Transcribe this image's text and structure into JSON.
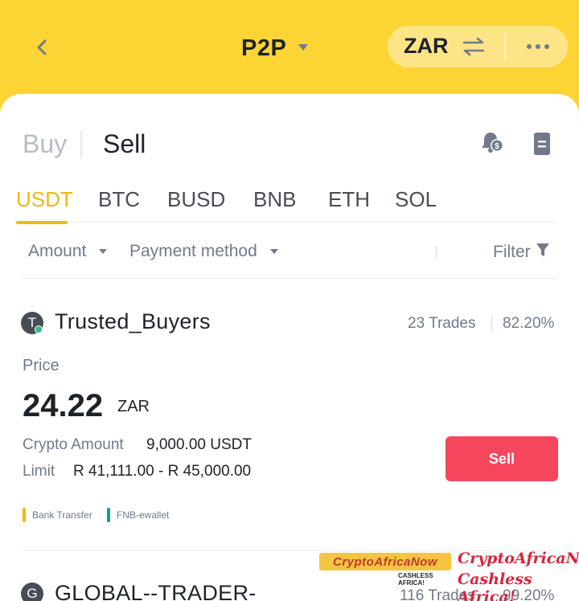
{
  "header": {
    "title": "P2P",
    "currency": "ZAR"
  },
  "tabs": {
    "buy_label": "Buy",
    "sell_label": "Sell",
    "active": "Sell"
  },
  "coins": [
    {
      "label": "USDT",
      "active": true
    },
    {
      "label": "BTC",
      "active": false
    },
    {
      "label": "BUSD",
      "active": false
    },
    {
      "label": "BNB",
      "active": false
    },
    {
      "label": "ETH",
      "active": false
    },
    {
      "label": "SOL",
      "active": false
    }
  ],
  "filters": {
    "amount_label": "Amount",
    "payment_label": "Payment method",
    "filter_label": "Filter"
  },
  "ads": [
    {
      "avatar_letter": "T",
      "merchant": "Trusted_Buyers",
      "trades": "23 Trades",
      "completion": "82.20%",
      "price_label": "Price",
      "price": "24.22",
      "price_currency": "ZAR",
      "crypto_amount_label": "Crypto Amount",
      "crypto_amount": "9,000.00 USDT",
      "limit_label": "Limit",
      "limit": "R 41,111.00 - R 45,000.00",
      "action_label": "Sell",
      "payment_methods": [
        {
          "label": "Bank Transfer",
          "color": "#F0B90B"
        },
        {
          "label": "FNB-ewallet",
          "color": "#0E9E94"
        }
      ]
    },
    {
      "avatar_letter": "G",
      "merchant": "GLOBAL--TRADER-",
      "trades": "116 Trades",
      "completion": "99.20%"
    }
  ],
  "watermark": {
    "logo_text": "CryptoAfricaNow",
    "logo_tagline": "CASHLESS AFRICA!",
    "line1": "CryptoAfricaNow",
    "line2": "Cashless Africa!"
  },
  "colors": {
    "brand_yellow": "#FCD535",
    "accent": "#F0B90B",
    "sell_red": "#F6465D",
    "online_green": "#2EBD85"
  },
  "icons": [
    "back-arrow-icon",
    "caret-down-icon",
    "swap-icon",
    "more-icon",
    "bell-dollar-icon",
    "order-document-icon",
    "filter-funnel-icon"
  ]
}
